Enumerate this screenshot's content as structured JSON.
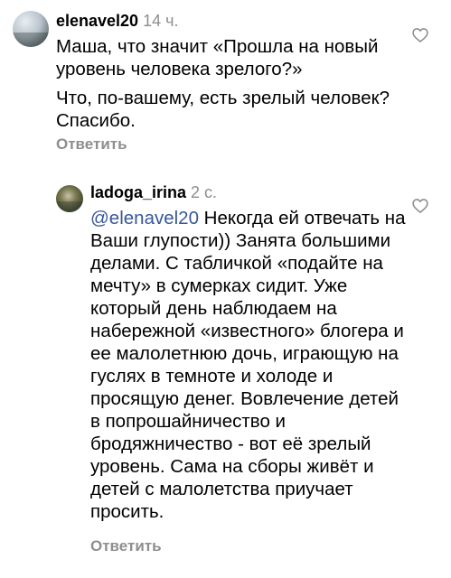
{
  "comments": [
    {
      "username": "elenavel20",
      "time": "14 ч.",
      "paragraphs": [
        "Маша, что значит «Прошла на новый уровень человека зрелого?»",
        "Что, по-вашему, есть зрелый человек? Спасибо."
      ],
      "reply_label": "Ответить",
      "like_icon": "heart-outline-icon"
    },
    {
      "username": "ladoga_irina",
      "time": "2 с.",
      "mention": "@elenavel20",
      "text": " Некогда ей отвечать на Ваши глупости)) Занята большими делами. С табличкой «подайте на мечту» в сумерках сидит. Уже который день наблюдаем на набережной «известного» блогера и ее малолетнюю дочь, играющую на гуслях в темноте и холоде и просящую денег.  Вовлечение детей в попрошайничество и бродяжничество - вот её зрелый уровень. Сама на сборы живёт и детей с малолетства приучает просить.",
      "reply_label": "Ответить",
      "like_icon": "heart-outline-icon"
    }
  ],
  "colors": {
    "text": "#000000",
    "muted": "#8e8e8e",
    "mention": "#385898"
  }
}
